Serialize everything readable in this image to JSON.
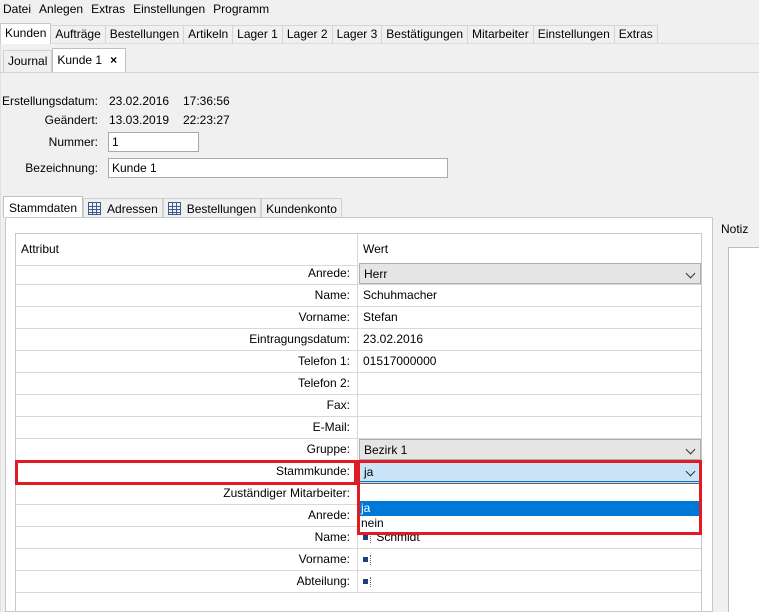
{
  "menu": [
    "Datei",
    "Anlegen",
    "Extras",
    "Einstellungen",
    "Programm"
  ],
  "main_tabs": [
    "Kunden",
    "Aufträge",
    "Bestellungen",
    "Artikeln",
    "Lager 1",
    "Lager 2",
    "Lager 3",
    "Bestätigungen",
    "Mitarbeiter",
    "Einstellungen",
    "Extras"
  ],
  "sub_tabs": {
    "journal": "Journal",
    "current": "Kunde 1",
    "close": "×"
  },
  "header": {
    "created_label": "Erstellungsdatum:",
    "created_date": "23.02.2016",
    "created_time": "17:36:56",
    "changed_label": "Geändert:",
    "changed_date": "13.03.2019",
    "changed_time": "22:23:27",
    "number_label": "Nummer:",
    "number_value": "1",
    "name_label": "Bezeichnung:",
    "name_value": "Kunde 1"
  },
  "detail_tabs": [
    "Stammdaten",
    "Adressen",
    "Bestellungen",
    "Kundenkonto"
  ],
  "notiz_label": "Notiz",
  "table": {
    "col_attr": "Attribut",
    "col_val": "Wert",
    "rows": [
      {
        "attr": "Anrede:",
        "value": "Herr"
      },
      {
        "attr": "Name:",
        "value": "Schuhmacher"
      },
      {
        "attr": "Vorname:",
        "value": "Stefan"
      },
      {
        "attr": "Eintragungsdatum:",
        "value": "23.02.2016"
      },
      {
        "attr": "Telefon 1:",
        "value": "01517000000"
      },
      {
        "attr": "Telefon 2:",
        "value": ""
      },
      {
        "attr": "Fax:",
        "value": ""
      },
      {
        "attr": "E-Mail:",
        "value": ""
      },
      {
        "attr": "Gruppe:",
        "value": "Bezirk 1"
      },
      {
        "attr": "Stammkunde:",
        "value": "ja"
      },
      {
        "attr": "Zuständiger Mitarbeiter:",
        "value": ""
      },
      {
        "attr": "Anrede:",
        "value": ""
      },
      {
        "attr": "Name:",
        "value": "Schmidt"
      },
      {
        "attr": "Vorname:",
        "value": ""
      },
      {
        "attr": "Abteilung:",
        "value": ""
      }
    ]
  },
  "dropdown": {
    "options": [
      "",
      "ja",
      "nein"
    ],
    "highlighted": "ja"
  },
  "colors": {
    "highlight": "#0078d7",
    "annotation": "#e01b24"
  }
}
